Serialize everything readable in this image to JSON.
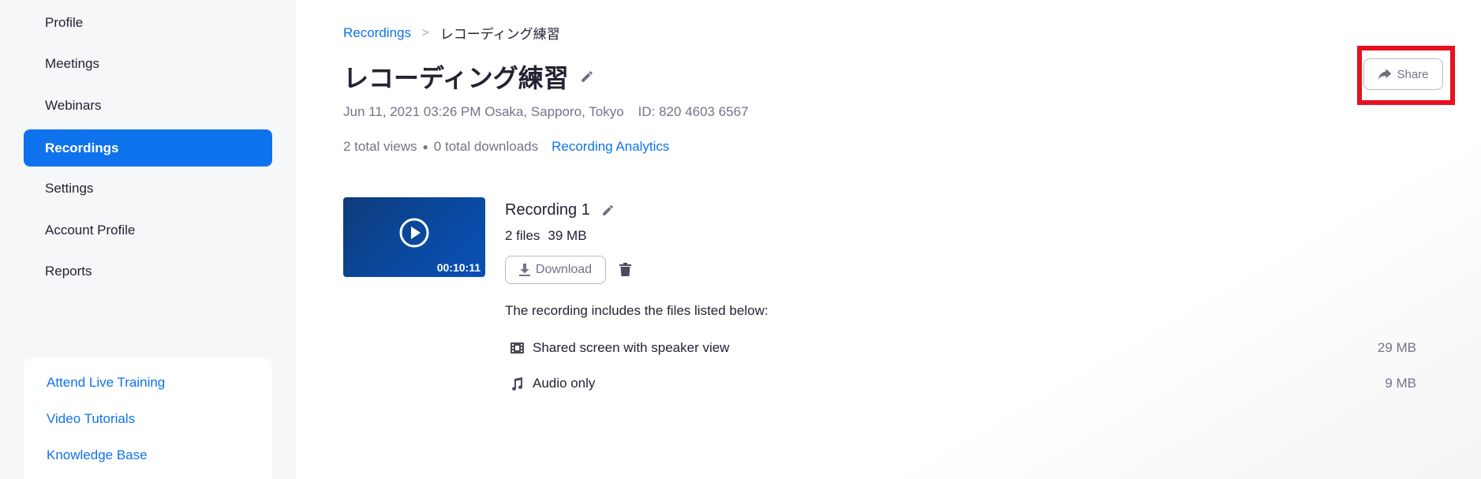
{
  "sidebar": {
    "items": [
      {
        "label": "Profile"
      },
      {
        "label": "Meetings"
      },
      {
        "label": "Webinars"
      },
      {
        "label": "Recordings",
        "active": true
      },
      {
        "label": "Settings"
      },
      {
        "label": "Account Profile"
      },
      {
        "label": "Reports"
      }
    ],
    "help_links": [
      {
        "label": "Attend Live Training"
      },
      {
        "label": "Video Tutorials"
      },
      {
        "label": "Knowledge Base"
      }
    ]
  },
  "breadcrumb": {
    "parent": "Recordings",
    "separator": ">",
    "current": "レコーディング練習"
  },
  "page": {
    "title": "レコーディング練習",
    "datetime": "Jun 11, 2021 03:26 PM Osaka, Sapporo, Tokyo",
    "meeting_id": "ID: 820 4603 6567",
    "views": "2 total views",
    "downloads": "0 total downloads",
    "analytics_link": "Recording Analytics",
    "share_label": "Share"
  },
  "recording": {
    "title": "Recording 1",
    "file_count": "2 files",
    "total_size": "39 MB",
    "duration": "00:10:11",
    "download_label": "Download",
    "files_heading": "The recording includes the files listed below:",
    "files": [
      {
        "icon": "film-icon",
        "name": "Shared screen with speaker view",
        "size": "29 MB"
      },
      {
        "icon": "music-note-icon",
        "name": "Audio only",
        "size": "9 MB"
      }
    ]
  },
  "colors": {
    "accent": "#0e72ed",
    "highlight": "#e8101f",
    "thumbnail": "#0a4aa3"
  }
}
